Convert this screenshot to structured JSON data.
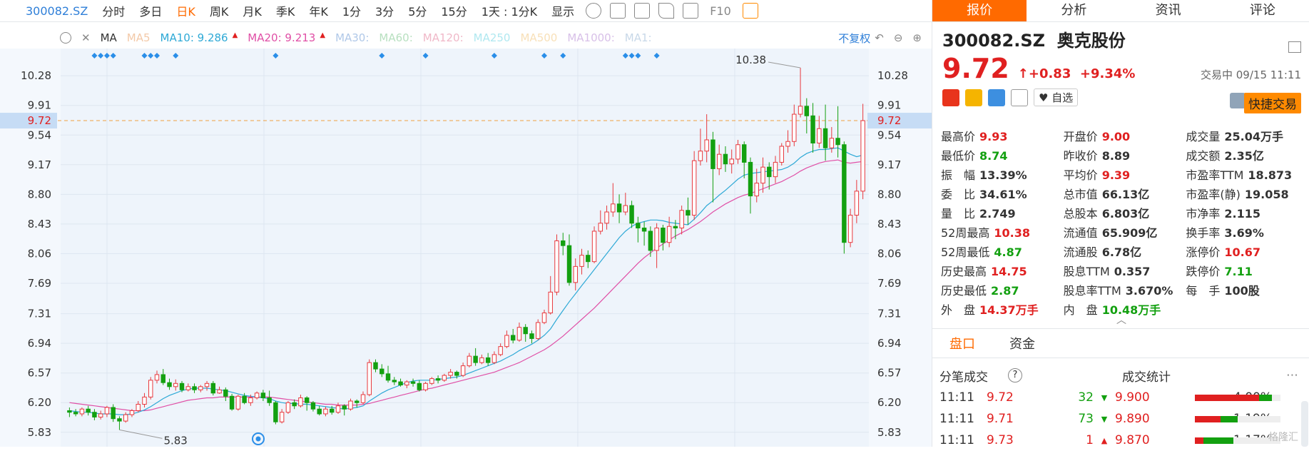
{
  "toolbar": {
    "symbol": "300082.SZ",
    "periods": [
      "分时",
      "多日",
      "日K",
      "周K",
      "月K",
      "季K",
      "年K",
      "1分",
      "3分",
      "5分",
      "15分"
    ],
    "active_period": "日K",
    "range": "1天 : 1分K",
    "display": "显示",
    "f10": "F10"
  },
  "ma_bar": {
    "type": "MA",
    "items": [
      {
        "label": "MA5",
        "color": "#f3c9a8"
      },
      {
        "label": "MA10: 9.286",
        "color": "#2ea9d6"
      },
      {
        "label": "MA20: 9.213",
        "color": "#e04fa6"
      },
      {
        "label": "MA30:",
        "color": "#b0c8e8"
      },
      {
        "label": "MA60:",
        "color": "#b8e0c0"
      },
      {
        "label": "MA120:",
        "color": "#f0b8c8"
      },
      {
        "label": "MA250",
        "color": "#b0e8f0"
      },
      {
        "label": "MA500",
        "color": "#f8e0b8"
      },
      {
        "label": "MA1000:",
        "color": "#d8c0e8"
      },
      {
        "label": "MA1:",
        "color": "#c8d8e8"
      }
    ],
    "fuquan": "不复权"
  },
  "chart_data": {
    "type": "candlestick",
    "y_ticks": [
      10.28,
      9.91,
      9.54,
      9.17,
      8.8,
      8.43,
      8.06,
      7.69,
      7.31,
      6.94,
      6.57,
      6.2,
      5.83
    ],
    "current_price_label": "9.72",
    "max_label": "10.38",
    "min_label": "5.83",
    "ylim": [
      5.65,
      10.62
    ],
    "candles": [
      [
        6.1,
        6.08,
        6.14,
        6.02
      ],
      [
        6.08,
        6.06,
        6.12,
        6.03
      ],
      [
        6.06,
        6.12,
        6.14,
        6.03
      ],
      [
        6.12,
        6.08,
        6.16,
        6.04
      ],
      [
        6.08,
        6.02,
        6.12,
        5.98
      ],
      [
        6.02,
        6.06,
        6.1,
        5.99
      ],
      [
        6.06,
        6.14,
        6.16,
        6.02
      ],
      [
        6.14,
        6.0,
        6.18,
        5.96
      ],
      [
        6.0,
        5.97,
        6.03,
        5.86
      ],
      [
        5.97,
        6.05,
        6.08,
        5.95
      ],
      [
        6.05,
        6.1,
        6.12,
        6.02
      ],
      [
        6.1,
        6.18,
        6.22,
        6.08
      ],
      [
        6.18,
        6.27,
        6.32,
        6.14
      ],
      [
        6.27,
        6.48,
        6.52,
        6.24
      ],
      [
        6.48,
        6.55,
        6.6,
        6.44
      ],
      [
        6.55,
        6.45,
        6.62,
        6.42
      ],
      [
        6.45,
        6.4,
        6.5,
        6.36
      ],
      [
        6.4,
        6.44,
        6.49,
        6.35
      ],
      [
        6.44,
        6.36,
        6.47,
        6.33
      ],
      [
        6.36,
        6.4,
        6.44,
        6.34
      ],
      [
        6.4,
        6.36,
        6.44,
        6.32
      ],
      [
        6.36,
        6.4,
        6.42,
        6.33
      ],
      [
        6.4,
        6.44,
        6.47,
        6.35
      ],
      [
        6.44,
        6.32,
        6.47,
        6.29
      ],
      [
        6.32,
        6.36,
        6.4,
        6.31
      ],
      [
        6.36,
        6.28,
        6.39,
        6.22
      ],
      [
        6.28,
        6.12,
        6.31,
        6.1
      ],
      [
        6.12,
        6.28,
        6.3,
        6.1
      ],
      [
        6.28,
        6.2,
        6.32,
        6.18
      ],
      [
        6.2,
        6.26,
        6.3,
        6.16
      ],
      [
        6.26,
        6.32,
        6.34,
        6.24
      ],
      [
        6.32,
        6.26,
        6.36,
        6.22
      ],
      [
        6.26,
        6.2,
        6.35,
        6.16
      ],
      [
        6.2,
        5.96,
        6.22,
        5.93
      ],
      [
        5.96,
        6.08,
        6.12,
        5.94
      ],
      [
        6.08,
        6.2,
        6.22,
        6.06
      ],
      [
        6.2,
        6.16,
        6.24,
        6.12
      ],
      [
        6.16,
        6.26,
        6.3,
        6.14
      ],
      [
        6.26,
        6.2,
        6.28,
        6.1
      ],
      [
        6.2,
        6.12,
        6.22,
        6.09
      ],
      [
        6.12,
        6.06,
        6.16,
        6.04
      ],
      [
        6.06,
        6.12,
        6.15,
        6.03
      ],
      [
        6.12,
        6.08,
        6.16,
        6.05
      ],
      [
        6.08,
        6.16,
        6.2,
        6.06
      ],
      [
        6.16,
        6.12,
        6.18,
        6.04
      ],
      [
        6.12,
        6.22,
        6.25,
        6.1
      ],
      [
        6.22,
        6.2,
        6.24,
        6.14
      ],
      [
        6.2,
        6.3,
        6.34,
        6.18
      ],
      [
        6.3,
        6.7,
        6.74,
        6.28
      ],
      [
        6.7,
        6.62,
        6.74,
        6.58
      ],
      [
        6.62,
        6.56,
        6.68,
        6.52
      ],
      [
        6.56,
        6.48,
        6.66,
        6.45
      ],
      [
        6.48,
        6.46,
        6.52,
        6.42
      ],
      [
        6.46,
        6.42,
        6.5,
        6.4
      ],
      [
        6.42,
        6.46,
        6.48,
        6.38
      ],
      [
        6.46,
        6.44,
        6.5,
        6.4
      ],
      [
        6.44,
        6.36,
        6.48,
        6.34
      ],
      [
        6.36,
        6.44,
        6.46,
        6.34
      ],
      [
        6.44,
        6.5,
        6.52,
        6.42
      ],
      [
        6.5,
        6.48,
        6.54,
        6.44
      ],
      [
        6.48,
        6.54,
        6.56,
        6.46
      ],
      [
        6.54,
        6.58,
        6.62,
        6.5
      ],
      [
        6.58,
        6.54,
        6.6,
        6.5
      ],
      [
        6.54,
        6.66,
        6.7,
        6.52
      ],
      [
        6.66,
        6.78,
        6.82,
        6.64
      ],
      [
        6.78,
        6.7,
        6.88,
        6.66
      ],
      [
        6.7,
        6.76,
        6.8,
        6.68
      ],
      [
        6.76,
        6.7,
        6.82,
        6.66
      ],
      [
        6.7,
        6.8,
        6.84,
        6.68
      ],
      [
        6.8,
        6.9,
        6.94,
        6.78
      ],
      [
        6.9,
        7.04,
        7.1,
        6.88
      ],
      [
        7.04,
        6.98,
        7.12,
        6.94
      ],
      [
        6.98,
        7.14,
        7.2,
        6.96
      ],
      [
        7.14,
        7.06,
        7.18,
        6.96
      ],
      [
        7.06,
        7.0,
        7.1,
        6.94
      ],
      [
        7.0,
        7.2,
        7.24,
        6.98
      ],
      [
        7.2,
        7.32,
        7.36,
        7.18
      ],
      [
        7.32,
        7.58,
        7.78,
        7.3
      ],
      [
        7.58,
        8.22,
        8.3,
        7.54
      ],
      [
        8.22,
        8.16,
        8.32,
        8.04
      ],
      [
        8.16,
        7.7,
        8.3,
        7.66
      ],
      [
        7.7,
        7.9,
        8.0,
        7.6
      ],
      [
        7.9,
        8.04,
        8.12,
        7.8
      ],
      [
        8.04,
        7.96,
        8.1,
        7.88
      ],
      [
        7.96,
        8.34,
        8.4,
        7.94
      ],
      [
        8.34,
        8.44,
        8.6,
        8.3
      ],
      [
        8.44,
        8.58,
        8.66,
        8.36
      ],
      [
        8.58,
        8.68,
        8.94,
        8.52
      ],
      [
        8.68,
        8.58,
        8.8,
        8.44
      ],
      [
        8.58,
        8.66,
        8.82,
        8.54
      ],
      [
        8.66,
        8.44,
        8.72,
        8.38
      ],
      [
        8.44,
        8.38,
        8.52,
        8.2
      ],
      [
        8.38,
        8.34,
        8.46,
        8.16
      ],
      [
        8.34,
        8.1,
        8.4,
        8.02
      ],
      [
        8.1,
        8.38,
        8.44,
        7.88
      ],
      [
        8.38,
        8.2,
        8.42,
        8.1
      ],
      [
        8.2,
        8.4,
        8.52,
        8.14
      ],
      [
        8.4,
        8.38,
        8.48,
        8.24
      ],
      [
        8.38,
        8.6,
        8.66,
        8.3
      ],
      [
        8.6,
        8.54,
        8.76,
        8.42
      ],
      [
        8.54,
        9.22,
        9.34,
        8.48
      ],
      [
        9.22,
        9.34,
        9.62,
        9.16
      ],
      [
        9.34,
        9.48,
        9.8,
        9.2
      ],
      [
        9.48,
        9.12,
        9.58,
        8.7
      ],
      [
        9.12,
        9.3,
        9.42,
        9.04
      ],
      [
        9.3,
        9.18,
        9.4,
        9.08
      ],
      [
        9.18,
        9.24,
        9.36,
        9.06
      ],
      [
        9.24,
        9.42,
        9.48,
        9.18
      ],
      [
        9.42,
        9.2,
        9.46,
        9.0
      ],
      [
        9.2,
        8.78,
        9.26,
        8.56
      ],
      [
        8.78,
        8.94,
        9.12,
        8.7
      ],
      [
        8.94,
        9.14,
        9.26,
        8.82
      ],
      [
        9.14,
        9.02,
        9.2,
        8.86
      ],
      [
        9.02,
        9.2,
        9.28,
        8.94
      ],
      [
        9.2,
        9.4,
        9.44,
        9.16
      ],
      [
        9.4,
        9.46,
        9.6,
        9.32
      ],
      [
        9.46,
        9.8,
        9.92,
        9.4
      ],
      [
        9.8,
        9.9,
        10.38,
        9.76
      ],
      [
        9.9,
        9.78,
        10.0,
        9.56
      ],
      [
        9.78,
        9.44,
        9.94,
        9.32
      ],
      [
        9.44,
        9.62,
        9.78,
        9.38
      ],
      [
        9.62,
        9.38,
        9.92,
        9.22
      ],
      [
        9.38,
        9.5,
        9.64,
        9.32
      ],
      [
        9.5,
        9.42,
        9.9,
        9.26
      ],
      [
        9.42,
        8.2,
        9.46,
        8.06
      ],
      [
        8.2,
        8.54,
        8.62,
        8.14
      ],
      [
        8.54,
        8.84,
        8.98,
        8.44
      ],
      [
        8.84,
        9.72,
        9.93,
        8.74
      ]
    ],
    "ma10": [
      6.1,
      6.09,
      6.08,
      6.08,
      6.07,
      6.06,
      6.06,
      6.06,
      6.05,
      6.05,
      6.06,
      6.08,
      6.11,
      6.15,
      6.2,
      6.25,
      6.29,
      6.32,
      6.35,
      6.37,
      6.38,
      6.38,
      6.38,
      6.37,
      6.36,
      6.35,
      6.33,
      6.31,
      6.29,
      6.28,
      6.27,
      6.26,
      6.25,
      6.22,
      6.2,
      6.19,
      6.19,
      6.18,
      6.18,
      6.17,
      6.16,
      6.15,
      6.14,
      6.13,
      6.12,
      6.13,
      6.14,
      6.16,
      6.22,
      6.27,
      6.32,
      6.36,
      6.39,
      6.42,
      6.45,
      6.47,
      6.48,
      6.48,
      6.48,
      6.49,
      6.5,
      6.51,
      6.52,
      6.54,
      6.57,
      6.6,
      6.63,
      6.66,
      6.69,
      6.72,
      6.76,
      6.8,
      6.85,
      6.89,
      6.93,
      6.98,
      7.04,
      7.12,
      7.24,
      7.35,
      7.46,
      7.56,
      7.66,
      7.76,
      7.86,
      7.96,
      8.06,
      8.16,
      8.26,
      8.34,
      8.4,
      8.44,
      8.46,
      8.48,
      8.48,
      8.47,
      8.45,
      8.44,
      8.43,
      8.42,
      8.49,
      8.57,
      8.66,
      8.72,
      8.79,
      8.85,
      8.92,
      8.99,
      9.04,
      9.06,
      9.07,
      9.08,
      9.09,
      9.1,
      9.11,
      9.14,
      9.19,
      9.26,
      9.31,
      9.34,
      9.36,
      9.36,
      9.37,
      9.38,
      9.34,
      9.3,
      9.27,
      9.29
    ],
    "ma20": [
      6.2,
      6.19,
      6.18,
      6.17,
      6.16,
      6.15,
      6.14,
      6.13,
      6.12,
      6.11,
      6.1,
      6.1,
      6.1,
      6.11,
      6.13,
      6.15,
      6.17,
      6.19,
      6.21,
      6.23,
      6.24,
      6.25,
      6.26,
      6.26,
      6.27,
      6.27,
      6.27,
      6.27,
      6.27,
      6.27,
      6.27,
      6.27,
      6.27,
      6.26,
      6.25,
      6.24,
      6.23,
      6.22,
      6.21,
      6.2,
      6.19,
      6.18,
      6.18,
      6.17,
      6.17,
      6.17,
      6.17,
      6.18,
      6.19,
      6.21,
      6.23,
      6.25,
      6.27,
      6.29,
      6.31,
      6.33,
      6.35,
      6.37,
      6.38,
      6.4,
      6.42,
      6.44,
      6.46,
      6.48,
      6.5,
      6.52,
      6.54,
      6.56,
      6.58,
      6.61,
      6.64,
      6.67,
      6.7,
      6.74,
      6.78,
      6.82,
      6.86,
      6.91,
      6.97,
      7.03,
      7.1,
      7.17,
      7.24,
      7.31,
      7.38,
      7.46,
      7.54,
      7.62,
      7.7,
      7.78,
      7.86,
      7.94,
      8.01,
      8.07,
      8.13,
      8.18,
      8.23,
      8.28,
      8.32,
      8.36,
      8.41,
      8.46,
      8.52,
      8.58,
      8.63,
      8.68,
      8.72,
      8.76,
      8.79,
      8.81,
      8.84,
      8.87,
      8.9,
      8.93,
      8.96,
      9.0,
      9.04,
      9.09,
      9.13,
      9.16,
      9.19,
      9.21,
      9.22,
      9.23,
      9.2,
      9.19,
      9.2,
      9.21
    ],
    "signal_dots": [
      4,
      5,
      6,
      7,
      12,
      13,
      14,
      17,
      33,
      50,
      57,
      68,
      76,
      79,
      89,
      90,
      91,
      94
    ]
  },
  "right": {
    "tabs": [
      "报价",
      "分析",
      "资讯",
      "评论"
    ],
    "active_tab": "报价",
    "code": "300082.SZ",
    "name": "奥克股份",
    "price": "9.72",
    "arrow": "↑",
    "change": "+0.83",
    "change_pct": "+9.34%",
    "status": "交易中 09/15 11:11",
    "zixuan": "自选",
    "quick_trade": "快捷交易",
    "metrics": [
      [
        {
          "label": "最高价",
          "value": "9.93",
          "color": "red"
        },
        {
          "label": "开盘价",
          "value": "9.00",
          "color": "red"
        },
        {
          "label": "成交量",
          "value": "25.04万手",
          "color": "dark"
        }
      ],
      [
        {
          "label": "最低价",
          "value": "8.74",
          "color": "green"
        },
        {
          "label": "昨收价",
          "value": "8.89",
          "color": "dark"
        },
        {
          "label": "成交额",
          "value": "2.35亿",
          "color": "dark"
        }
      ],
      [
        {
          "label": "振　幅",
          "value": "13.39%",
          "color": "dark"
        },
        {
          "label": "平均价",
          "value": "9.39",
          "color": "red"
        },
        {
          "label": "市盈率TTM",
          "value": "18.873",
          "color": "dark"
        }
      ],
      [
        {
          "label": "委　比",
          "value": "34.61%",
          "color": "dark"
        },
        {
          "label": "总市值",
          "value": "66.13亿",
          "color": "dark"
        },
        {
          "label": "市盈率(静)",
          "value": "19.058",
          "color": "dark"
        }
      ],
      [
        {
          "label": "量　比",
          "value": "2.749",
          "color": "dark"
        },
        {
          "label": "总股本",
          "value": "6.803亿",
          "color": "dark"
        },
        {
          "label": "市净率",
          "value": "2.115",
          "color": "dark"
        }
      ],
      [
        {
          "label": "52周最高",
          "value": "10.38",
          "color": "red"
        },
        {
          "label": "流通值",
          "value": "65.909亿",
          "color": "dark"
        },
        {
          "label": "换手率",
          "value": "3.69%",
          "color": "dark"
        }
      ],
      [
        {
          "label": "52周最低",
          "value": "4.87",
          "color": "green"
        },
        {
          "label": "流通股",
          "value": "6.78亿",
          "color": "dark"
        },
        {
          "label": "涨停价",
          "value": "10.67",
          "color": "red"
        }
      ],
      [
        {
          "label": "历史最高",
          "value": "14.75",
          "color": "red"
        },
        {
          "label": "股息TTM",
          "value": "0.357",
          "color": "dark"
        },
        {
          "label": "跌停价",
          "value": "7.11",
          "color": "green"
        }
      ],
      [
        {
          "label": "历史最低",
          "value": "2.87",
          "color": "green"
        },
        {
          "label": "股息率TTM",
          "value": "3.670%",
          "color": "dark"
        },
        {
          "label": "每　手",
          "value": "100股",
          "color": "dark"
        }
      ],
      [
        {
          "label": "外　盘",
          "value": "14.37万手",
          "color": "red"
        },
        {
          "label": "内　盘",
          "value": "10.48万手",
          "color": "green"
        },
        {
          "label": "",
          "value": "",
          "color": "dark"
        }
      ]
    ],
    "panel_tabs": [
      "盘口",
      "资金"
    ],
    "active_panel": "盘口",
    "trades_title": "分笔成交",
    "stats_title": "成交统计",
    "trades": [
      {
        "time": "11:11",
        "price": "9.72",
        "vol": "32",
        "dir": "down"
      },
      {
        "time": "11:11",
        "price": "9.71",
        "vol": "73",
        "dir": "down"
      },
      {
        "time": "11:11",
        "price": "9.73",
        "vol": "1",
        "dir": "up"
      }
    ],
    "stats": [
      {
        "price": "9.900",
        "pct": "4.00%",
        "red": 0.75,
        "green": 0.15
      },
      {
        "price": "9.890",
        "pct": "1.19%",
        "red": 0.3,
        "green": 0.2
      },
      {
        "price": "9.870",
        "pct": "1.17%",
        "red": 0.1,
        "green": 0.35
      }
    ],
    "watermark": "格隆汇"
  }
}
